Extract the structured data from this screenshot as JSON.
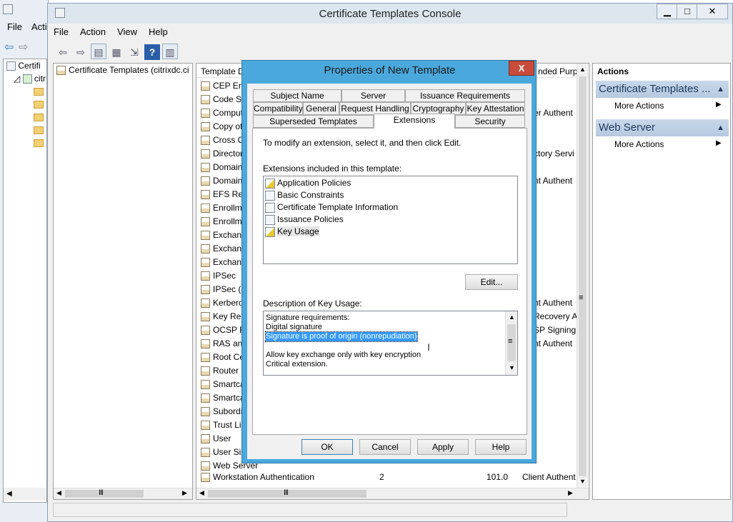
{
  "bg_window": {
    "menu": [
      "File",
      "Acti"
    ],
    "tree_label": "Certifi",
    "node_label": "citr"
  },
  "window": {
    "title": "Certificate Templates Console",
    "minimize": "▁",
    "maximize": "□",
    "close": "✕"
  },
  "menubar": [
    "File",
    "Action",
    "View",
    "Help"
  ],
  "toolbar_icons": [
    "back-icon",
    "forward-icon",
    "show-tree-icon",
    "properties-icon",
    "export-icon",
    "help-icon",
    "show-action-pane-icon"
  ],
  "tree": {
    "root": "Certificate Templates (citrixdc.ci"
  },
  "list": {
    "header_name": "Template D",
    "header_purpose": "nded Purpo",
    "rows": [
      {
        "name": "CEP Enc",
        "purpose": ""
      },
      {
        "name": "Code Si",
        "purpose": ""
      },
      {
        "name": "Comput",
        "purpose": "er Authent"
      },
      {
        "name": "Copy of",
        "purpose": ""
      },
      {
        "name": "Cross C",
        "purpose": ""
      },
      {
        "name": "Director",
        "purpose": "ctory Servi"
      },
      {
        "name": "Domain",
        "purpose": ""
      },
      {
        "name": "Domain",
        "purpose": "nt Authent"
      },
      {
        "name": "EFS Rec",
        "purpose": ""
      },
      {
        "name": "Enrollm",
        "purpose": ""
      },
      {
        "name": "Enrollm",
        "purpose": ""
      },
      {
        "name": "Exchang",
        "purpose": ""
      },
      {
        "name": "Exchang",
        "purpose": ""
      },
      {
        "name": "Exchang",
        "purpose": ""
      },
      {
        "name": "IPSec",
        "purpose": ""
      },
      {
        "name": "IPSec (O",
        "purpose": ""
      },
      {
        "name": "Kerbero",
        "purpose": "nt Authent"
      },
      {
        "name": "Key Rec",
        "purpose": "Recovery A"
      },
      {
        "name": "OCSP Re",
        "purpose": "SP Signing"
      },
      {
        "name": "RAS and",
        "purpose": "nt Authent"
      },
      {
        "name": "Root Ce",
        "purpose": ""
      },
      {
        "name": "Router (",
        "purpose": ""
      },
      {
        "name": "Smartca",
        "purpose": ""
      },
      {
        "name": "Smartca",
        "purpose": ""
      },
      {
        "name": "Subordi",
        "purpose": ""
      },
      {
        "name": "Trust Lis",
        "purpose": ""
      },
      {
        "name": "User",
        "purpose": ""
      },
      {
        "name": "User Sig",
        "purpose": ""
      },
      {
        "name": "Web Server",
        "purpose": ""
      }
    ],
    "last_row": {
      "name": "Workstation Authentication",
      "schema": "2",
      "version": "101.0",
      "purpose": "Client Authent"
    }
  },
  "actions": {
    "header": "Actions",
    "sections": [
      {
        "title": "Certificate Templates ...",
        "item": "More Actions"
      },
      {
        "title": "Web Server",
        "item": "More Actions"
      }
    ]
  },
  "dialog": {
    "title": "Properties of New Template",
    "close": "X",
    "tabs_row1": [
      "Subject Name",
      "Server",
      "Issuance Requirements"
    ],
    "tabs_row2": [
      "Compatibility",
      "General",
      "Request Handling",
      "Cryptography",
      "Key Attestation"
    ],
    "tabs_row3": [
      "Superseded Templates",
      "Extensions",
      "Security"
    ],
    "selected_tab": "Extensions",
    "instruction": "To modify an extension, select it, and then click Edit.",
    "extensions_label": "Extensions included in this template:",
    "extensions": [
      {
        "name": "Application Policies",
        "icon": "warning-icon"
      },
      {
        "name": "Basic Constraints",
        "icon": "extension-icon"
      },
      {
        "name": "Certificate Template Information",
        "icon": "extension-icon"
      },
      {
        "name": "Issuance Policies",
        "icon": "extension-icon"
      },
      {
        "name": "Key Usage",
        "icon": "warning-icon"
      }
    ],
    "edit_button": "Edit...",
    "description_label": "Description of Key Usage:",
    "description_lines": [
      "Signature requirements:",
      "Digital signature",
      "Signature is proof of origin (nonrepudiation)",
      "",
      "Allow key exchange only with key encryption",
      "Critical extension."
    ],
    "buttons": [
      "OK",
      "Cancel",
      "Apply",
      "Help"
    ]
  },
  "scroll_glyphs": {
    "up": "▲",
    "down": "▼",
    "left": "◀",
    "right": "▶",
    "grip": "Ⅲ",
    "vgrip": "≡"
  }
}
